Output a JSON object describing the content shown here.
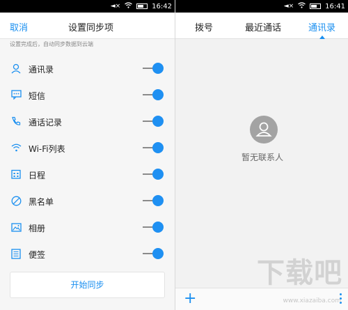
{
  "status_left": {
    "time": "16:42"
  },
  "status_right": {
    "time": "16:41"
  },
  "sync_settings": {
    "cancel_label": "取消",
    "title": "设置同步项",
    "hint": "设置完成后，自动同步数据到云端",
    "items": [
      {
        "label": "通讯录",
        "icon": "person-icon",
        "enabled": true
      },
      {
        "label": "短信",
        "icon": "message-icon",
        "enabled": true
      },
      {
        "label": "通话记录",
        "icon": "phone-icon",
        "enabled": true
      },
      {
        "label": "Wi-Fi列表",
        "icon": "wifi-icon",
        "enabled": true
      },
      {
        "label": "日程",
        "icon": "calendar-icon",
        "enabled": true
      },
      {
        "label": "黑名单",
        "icon": "blocked-icon",
        "enabled": true
      },
      {
        "label": "相册",
        "icon": "image-icon",
        "enabled": true
      },
      {
        "label": "便签",
        "icon": "note-icon",
        "enabled": true
      }
    ],
    "start_sync_label": "开始同步"
  },
  "contacts": {
    "tabs": [
      {
        "label": "拨号",
        "active": false
      },
      {
        "label": "最近通话",
        "active": false
      },
      {
        "label": "通讯录",
        "active": true
      }
    ],
    "empty_text": "暂无联系人"
  },
  "watermark": {
    "big": "下载吧",
    "small": "www.xiazaiba.com"
  },
  "colors": {
    "accent": "#1a8ff0",
    "switch_on": "#1f90f2"
  }
}
